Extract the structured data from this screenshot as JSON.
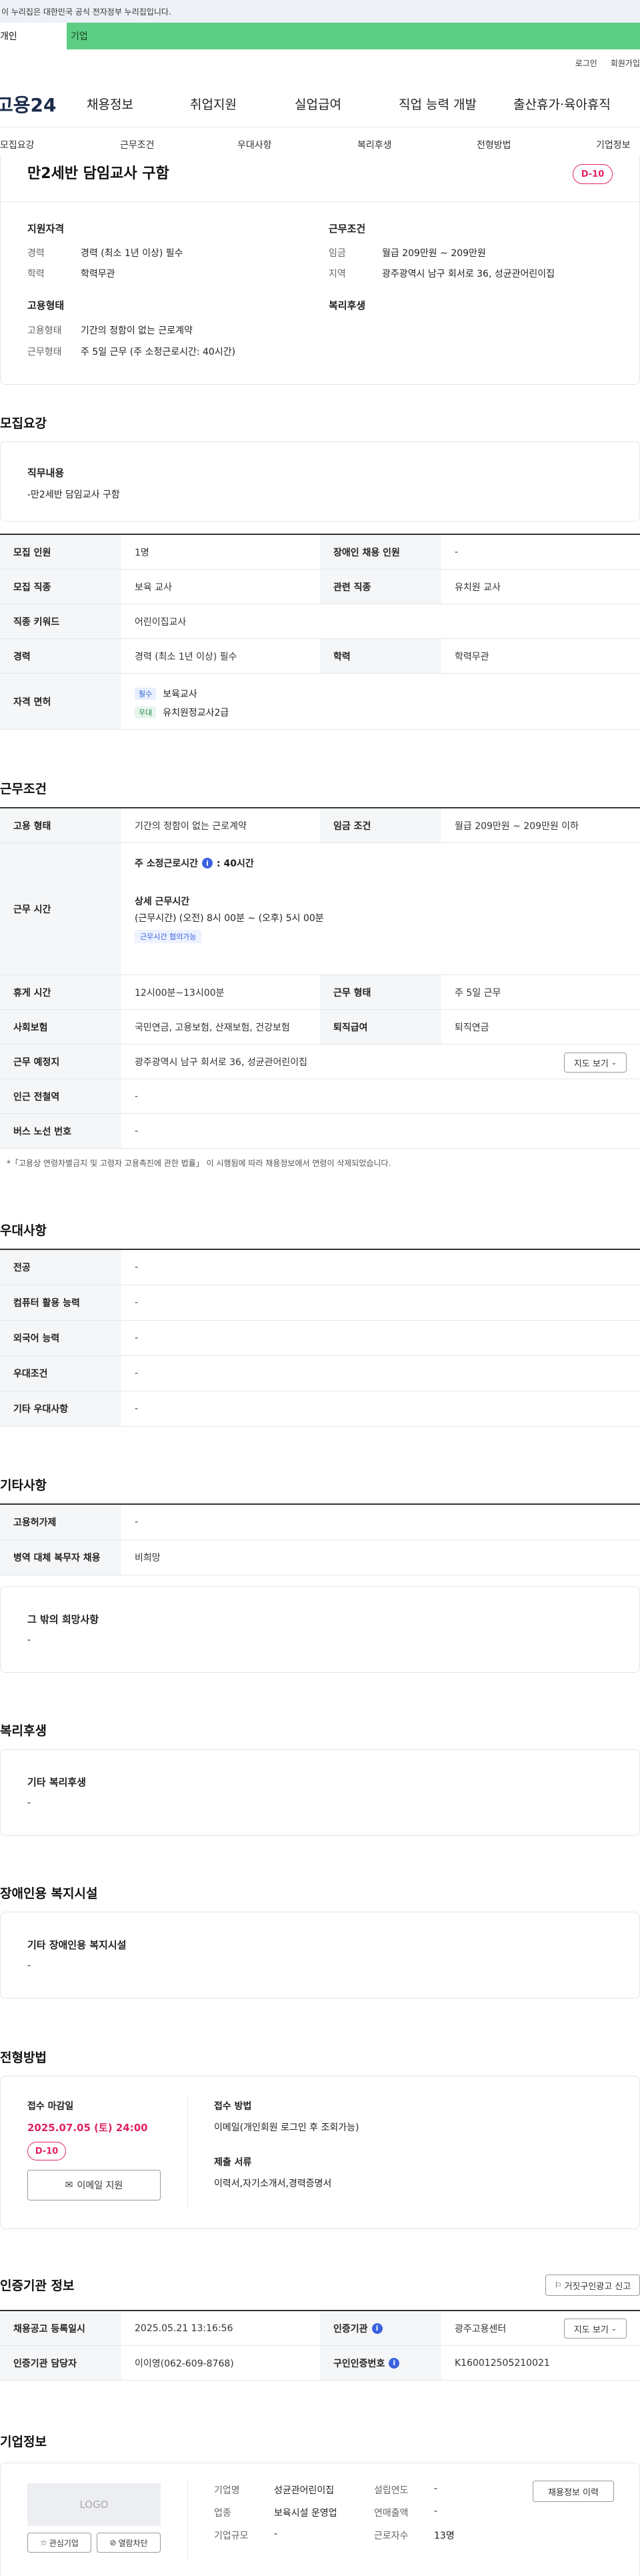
{
  "notice": "이 누리집은 대한민국 공식 전자정부 누리집입니다.",
  "user_tabs": {
    "person": "개인",
    "biz": "기업"
  },
  "top_links": {
    "login": "로그인",
    "signup": "회원가입"
  },
  "gnb": {
    "logo": "고용24",
    "items": [
      "채용정보",
      "취업지원",
      "실업급여",
      "직업 능력 개발",
      "출산휴가·육아휴직"
    ]
  },
  "subnav": [
    "모집요강",
    "근무조건",
    "우대사항",
    "복리후생",
    "전형방법",
    "기업정보"
  ],
  "summary": {
    "title": "만2세반 담임교사 구함",
    "dday": "D-10",
    "qual_label": "지원자격",
    "qual": [
      {
        "k": "경력",
        "v": "경력 (최소 1년 이상) 필수"
      },
      {
        "k": "학력",
        "v": "학력무관"
      }
    ],
    "cond_label": "근무조건",
    "cond": [
      {
        "k": "임금",
        "v": "월급 209만원 ~ 209만원"
      },
      {
        "k": "지역",
        "v": "광주광역시 남구 회서로 36, 성균관어린이집"
      }
    ],
    "emp_label": "고용형태",
    "emp": [
      {
        "k": "고용형태",
        "v": "기간의 정함이 없는 근로계약"
      },
      {
        "k": "근무형태",
        "v": "주 5일 근무 (주 소정근로시간: 40시간)"
      }
    ],
    "welfare_label": "복리후생"
  },
  "recruit": {
    "heading": "모집요강",
    "duty_label": "직무내용",
    "duty_text": "-만2세반 담임교사 구함",
    "rows": {
      "count_k": "모집 인원",
      "count_v": "1명",
      "disabled_k": "장애인 채용 인원",
      "disabled_v": "-",
      "job_k": "모집 직종",
      "job_v": "보육 교사",
      "rel_k": "관련 직종",
      "rel_v": "유치원 교사",
      "kw_k": "직종 키워드",
      "kw_v": "어린이집교사",
      "career_k": "경력",
      "career_v": "경력 (최소 1년 이상) 필수",
      "edu_k": "학력",
      "edu_v": "학력무관",
      "lic_k": "자격 면허",
      "lic_req_tag": "필수",
      "lic_req": "보육교사",
      "lic_pref_tag": "우대",
      "lic_pref": "유치원정교사2급"
    }
  },
  "work": {
    "heading": "근무조건",
    "type_k": "고용 형태",
    "type_v": "기간의 정함이 없는 근로계약",
    "pay_k": "임금 조건",
    "pay_v": "월급 209만원 ~ 209만원 이하",
    "hours_k": "근무 시간",
    "hours_total": "주 소정근로시간",
    "hours_total_v": ": 40시간",
    "hours_detail_label": "상세 근무시간",
    "hours_detail": "(근무시간) (오전) 8시 00분 ~ (오후) 5시 00분",
    "hours_chip": "근무시간 협의가능",
    "break_k": "휴게 시간",
    "break_v": "12시00분~13시00분",
    "form_k": "근무 형태",
    "form_v": "주 5일 근무",
    "ins_k": "사회보험",
    "ins_v": "국민연금, 고용보험, 산재보험, 건강보험",
    "sev_k": "퇴직급여",
    "sev_v": "퇴직연금",
    "loc_k": "근무 예정지",
    "loc_v": "광주광역시 남구 회서로 36, 성균관어린이집",
    "map_btn": "지도 보기",
    "sub_k": "인근 전철역",
    "sub_v": "-",
    "bus_k": "버스 노선 번호",
    "bus_v": "-",
    "note": "*「고용상 연령차별금지 및 고령자 고용촉진에 관한 법률」 이 시행됨에 따라 채용정보에서 연령이 삭제되었습니다."
  },
  "pref": {
    "heading": "우대사항",
    "rows": [
      {
        "k": "전공",
        "v": "-"
      },
      {
        "k": "컴퓨터 활용 능력",
        "v": "-"
      },
      {
        "k": "외국어 능력",
        "v": "-"
      },
      {
        "k": "우대조건",
        "v": "-"
      },
      {
        "k": "기타 우대사항",
        "v": "-"
      }
    ]
  },
  "etc": {
    "heading": "기타사항",
    "rows": [
      {
        "k": "고용허가제",
        "v": "-"
      },
      {
        "k": "병역 대체 복무자 채용",
        "v": "비희망"
      }
    ],
    "wish_label": "그 밖의 희망사항",
    "wish_v": "-"
  },
  "welfare": {
    "heading": "복리후생",
    "label": "기타 복리후생",
    "v": "-"
  },
  "disab": {
    "heading": "장애인용 복지시설",
    "label": "기타 장애인용 복지시설",
    "v": "-"
  },
  "process": {
    "heading": "전형방법",
    "deadline_label": "접수 마감일",
    "deadline": "2025.07.05 (토) 24:00",
    "dday": "D-10",
    "email_btn": "이메일 지원",
    "method_label": "접수 방법",
    "method_v": "이메일(개인회원 로그인 후 조회가능)",
    "docs_label": "제출 서류",
    "docs_v": "이력서,자기소개서,경력증명서"
  },
  "cert": {
    "heading": "인증기관 정보",
    "report_btn": "거짓구인광고 신고",
    "reg_k": "채용공고 등록일시",
    "reg_v": "2025.05.21 13:16:56",
    "org_k": "인증기관",
    "org_v": "광주고용센터",
    "map_btn": "지도 보기",
    "mgr_k": "인증기관 담당자",
    "mgr_v": "이이영(062-609-8768)",
    "no_k": "구인인증번호",
    "no_v": "K160012505210021"
  },
  "company": {
    "heading": "기업정보",
    "logo": "LOGO",
    "name_k": "기업명",
    "name_v": "성균관어린이집",
    "est_k": "설립연도",
    "est_v": "-",
    "ind_k": "업종",
    "ind_v": "보육시설 운영업",
    "sales_k": "연매출액",
    "sales_v": "-",
    "size_k": "기업규모",
    "size_v": "-",
    "emp_k": "근로자수",
    "emp_v": "13명",
    "history_btn": "채용정보 이력",
    "fav_btn": "관심기업",
    "block_btn": "열람차단"
  }
}
